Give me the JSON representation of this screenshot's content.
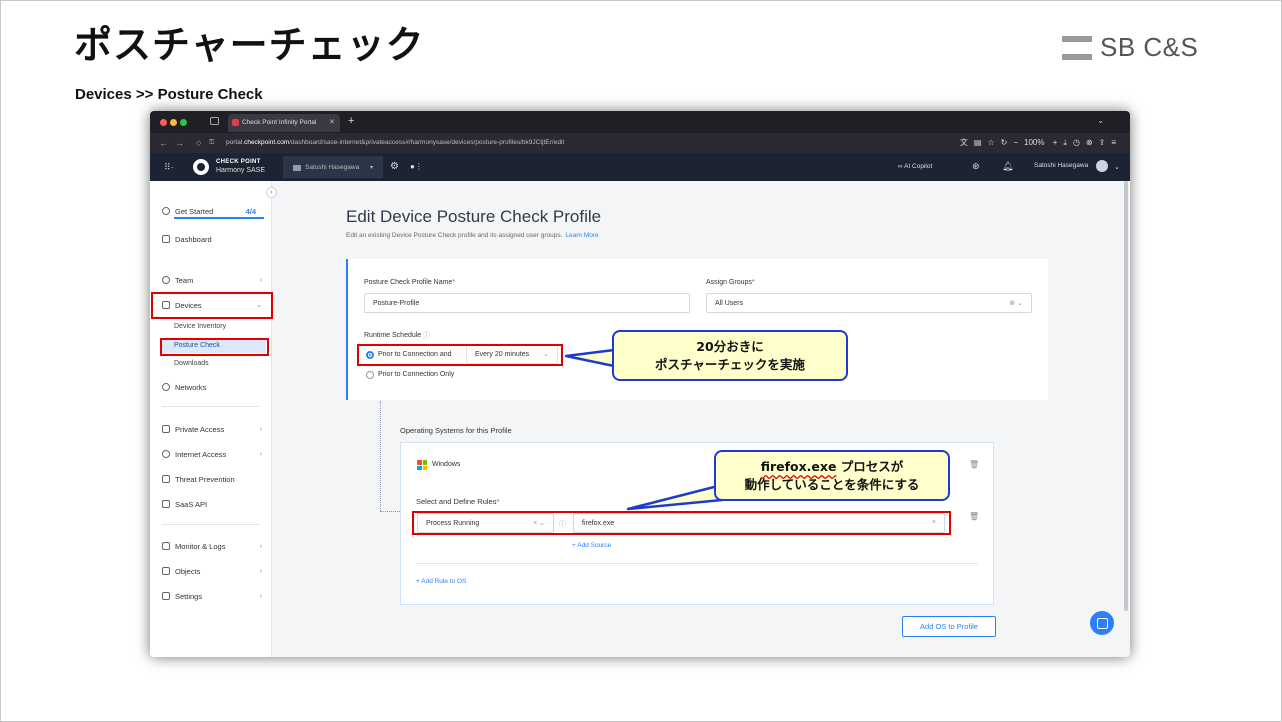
{
  "slide": {
    "title": "ポスチャーチェック",
    "breadcrumb": "Devices >> Posture Check",
    "logo_text": "SB C&S"
  },
  "browser": {
    "tab_title": "Check Point Infinity Portal",
    "url_prefix": "portal.",
    "url_domain": "checkpoint.com",
    "url_path": "/dashboard/sase-internet&privateaccess#/harmonysase/devices/posture-profiles/bk9JCtjtEr/edit",
    "zoom": "100%"
  },
  "appbar": {
    "brand": "CHECK POINT",
    "product": "Harmony SASE",
    "account": "Satoshi Hasegawa",
    "copilot": "AI Copilot",
    "user": "Satoshi Hasegawa"
  },
  "sidebar": {
    "get_started": "Get Started",
    "get_started_count": "4/4",
    "dashboard": "Dashboard",
    "team": "Team",
    "devices": "Devices",
    "device_inventory": "Device Inventory",
    "posture_check": "Posture Check",
    "downloads": "Downloads",
    "networks": "Networks",
    "private_access": "Private Access",
    "internet_access": "Internet Access",
    "threat_prevention": "Threat Prevention",
    "saas_api": "SaaS API",
    "monitor_logs": "Monitor & Logs",
    "objects": "Objects",
    "settings": "Settings"
  },
  "page": {
    "title": "Edit Device Posture Check Profile",
    "description": "Edit an existing Device Posture Check profile and its assigned user groups.",
    "learn_more": "Learn More",
    "profile_name_label": "Posture Check Profile Name",
    "profile_name_value": "Posture-Profile",
    "assign_groups_label": "Assign Groups",
    "assign_groups_value": "All Users",
    "runtime_label": "Runtime Schedule",
    "option_prior_and": "Prior to Connection and",
    "interval": "Every 20 minutes",
    "option_prior_only": "Prior to Connection Only",
    "os_section_title": "Operating Systems for this Profile",
    "os_name": "Windows",
    "rules_label": "Select and Define Rules",
    "rule_type": "Process Running",
    "rule_value": "firefox.exe",
    "add_source": "+ Add Source",
    "add_rule": "+ Add Rule to OS",
    "add_os": "Add OS to Profile"
  },
  "callouts": {
    "schedule_line1": "20分おきに",
    "schedule_line2": "ポスチャーチェックを実施",
    "process_line1_exe": "firefox.exe",
    "process_line1_rest": " プロセスが",
    "process_line2": "動作していることを条件にする"
  },
  "colors": {
    "accent": "#2d7ff9",
    "annotation_red": "#e00000",
    "callout_border": "#1d3ccf",
    "callout_fill": "#ffffcc",
    "appbar_bg": "#1c2433"
  }
}
